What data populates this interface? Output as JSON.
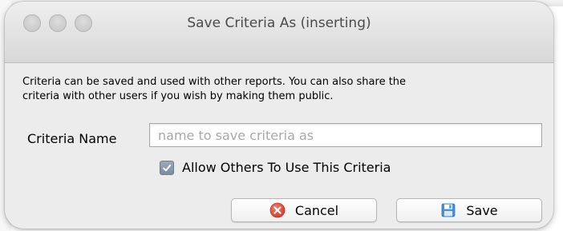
{
  "dialog": {
    "title": "Save Criteria As (inserting)",
    "description": "Criteria can be saved and used with other reports.  You can also share the\ncriteria with other users if you wish by making them public.",
    "criteria_label": "Criteria Name",
    "criteria_value": "",
    "criteria_placeholder": "name to save criteria as",
    "allow_others_label": "Allow Others To Use This Criteria",
    "allow_others_checked": true,
    "cancel_label": "Cancel",
    "save_label": "Save"
  },
  "icons": {
    "cancel": "cancel-icon",
    "save": "floppy-disk-icon",
    "checkbox": "checkmark-icon"
  },
  "colors": {
    "cancel_icon": "#e2513e",
    "save_icon": "#4e8fd6",
    "checkbox": "#8b99aa"
  }
}
